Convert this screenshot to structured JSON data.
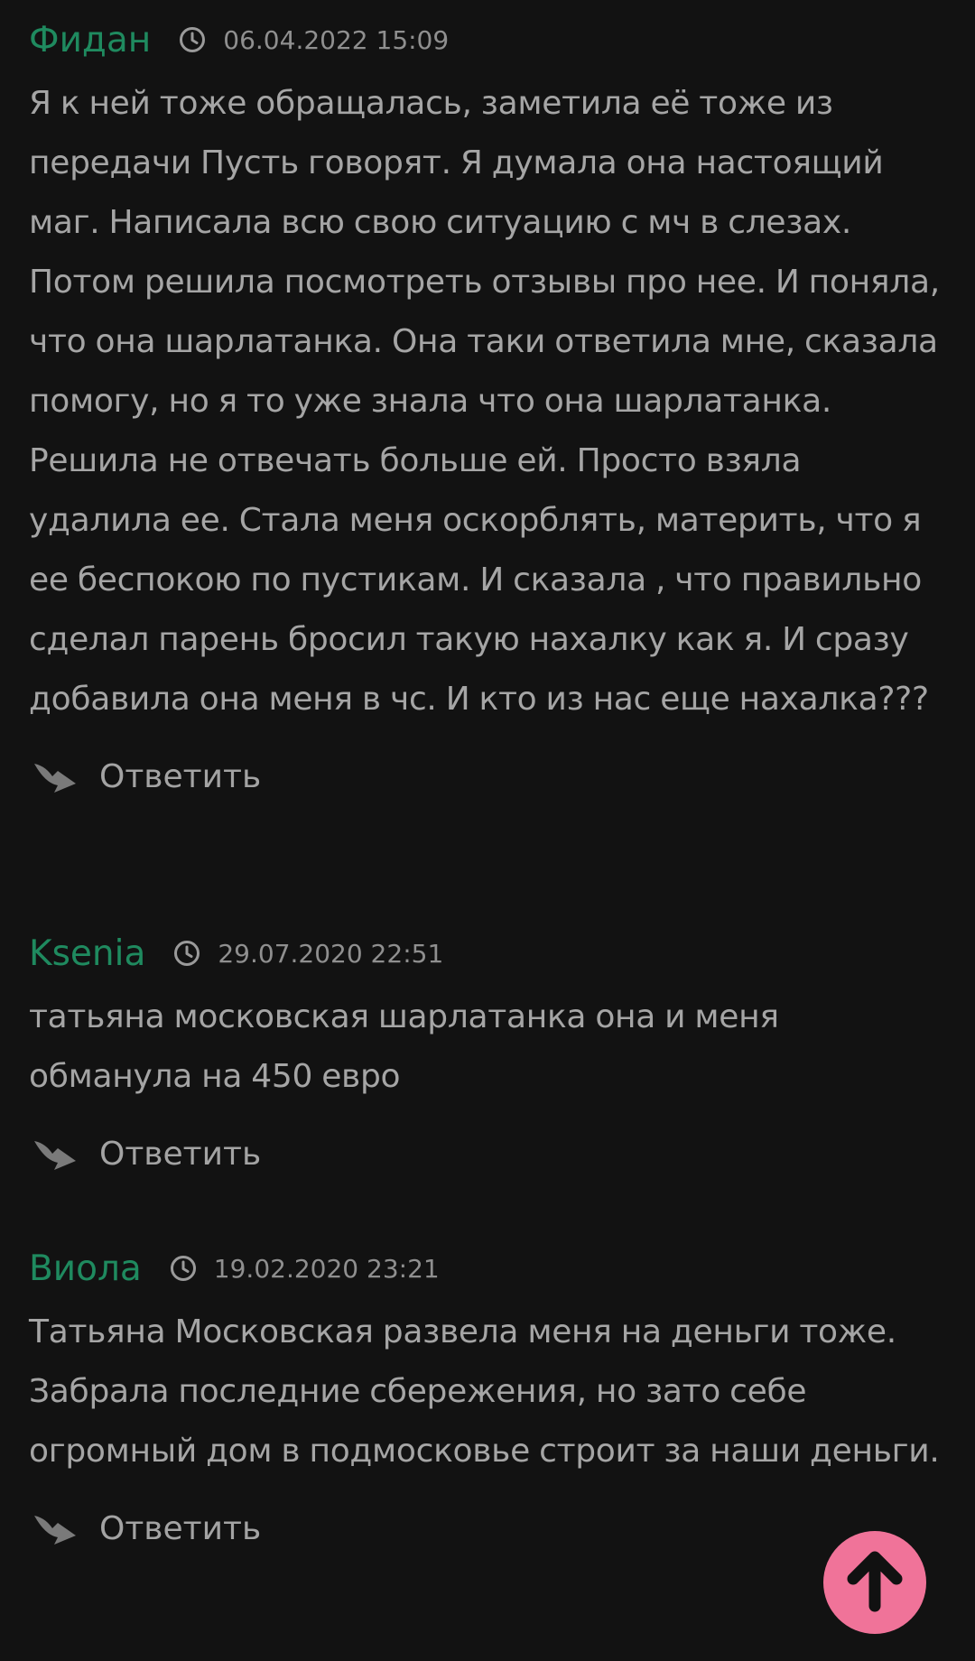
{
  "comments": [
    {
      "author": "Фидан",
      "date": "06.04.2022 15:09",
      "text": "Я к ней тоже обращалась, заметила её тоже из передачи Пусть говорят. Я думала она настоящий маг. Написала всю свою ситуацию с мч в слезах. Потом решила посмотреть отзывы про нее. И поняла, что она шарлатанка. Она таки ответила мне, сказала помогу, но я то уже знала что она шарлатанка. Решила не отвечать больше ей. Просто взяла удалила ее. Стала меня оскорблять, материть, что я ее беспокою по пустикам. И сказала , что правильно сделал парень бросил такую нахалку как я. И сразу добавила она меня в чс. И кто из нас еще нахалка???",
      "reply_label": "Ответить"
    },
    {
      "author": "Ksenia",
      "date": "29.07.2020 22:51",
      "text": "татьяна московская шарлатанка она и меня обманула на 450 евро",
      "reply_label": "Ответить"
    },
    {
      "author": "Виола",
      "date": "19.02.2020 23:21",
      "text": "Татьяна Московская развела меня на деньги тоже. Забрала последние сбережения, но зато себе огромный дом в подмосковье строит за наши деньги.",
      "reply_label": "Ответить"
    }
  ],
  "icons": {
    "clock": "clock-icon",
    "reply": "reply-arrow-icon",
    "scroll_up": "arrow-up-icon"
  },
  "colors": {
    "background": "#121212",
    "author": "#1f8a5f",
    "text": "#a5a5a5",
    "scroll_up_button": "#f07399"
  }
}
